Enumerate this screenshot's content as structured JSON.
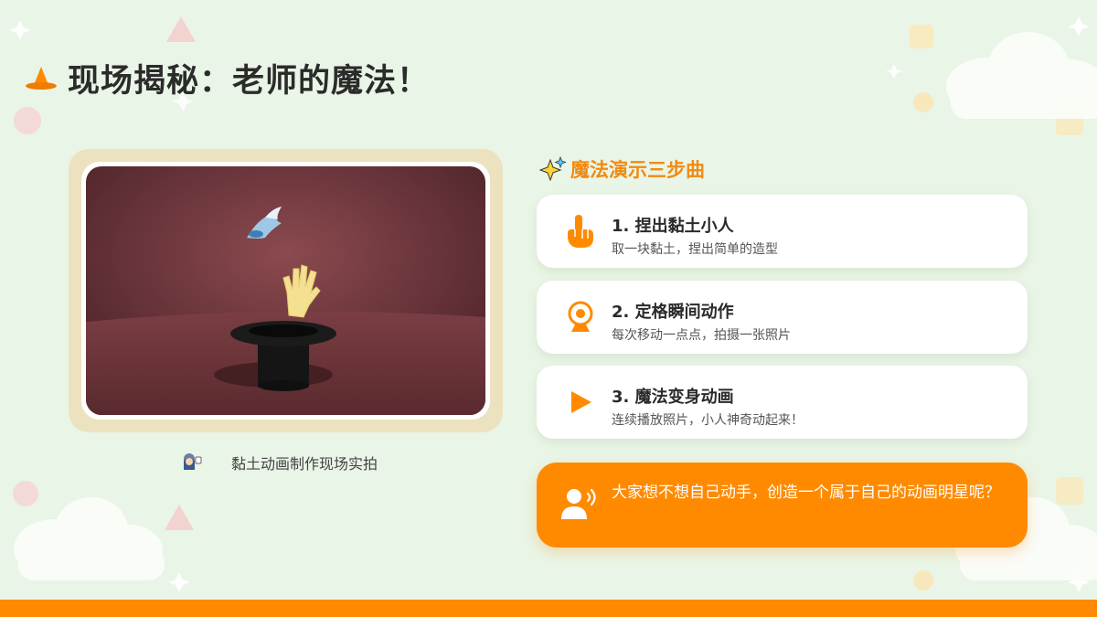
{
  "page": {
    "title": "现场揭秘：老师的魔法！",
    "title_icon": "wizard-hat-icon"
  },
  "photo": {
    "alt": "magic-hat-clay-animation-photo",
    "caption": "黏土动画制作现场实拍",
    "caption_icon": "person-icon"
  },
  "steps": {
    "title": "魔法演示三步曲",
    "title_icon": "sparkles-icon",
    "items": [
      {
        "title": "1. 捏出黏土小人",
        "desc": "取一块黏土，捏出简单的造型",
        "icon": "pointing-hand-icon"
      },
      {
        "title": "2. 定格瞬间动作",
        "desc": "每次移动一点点，拍摄一张照片",
        "icon": "camera-icon"
      },
      {
        "title": "3. 魔法变身动画",
        "desc": "连续播放照片，小人神奇动起来！",
        "icon": "play-icon"
      }
    ]
  },
  "cta": {
    "text": "大家想不想自己动手，创造一个属于自己的动画明星呢？",
    "icon": "speaking-person-icon"
  },
  "colors": {
    "accent": "#ff8a00",
    "background": "#e9f5e6",
    "title": "#2b2b2b",
    "steps_title": "#f28a12"
  }
}
